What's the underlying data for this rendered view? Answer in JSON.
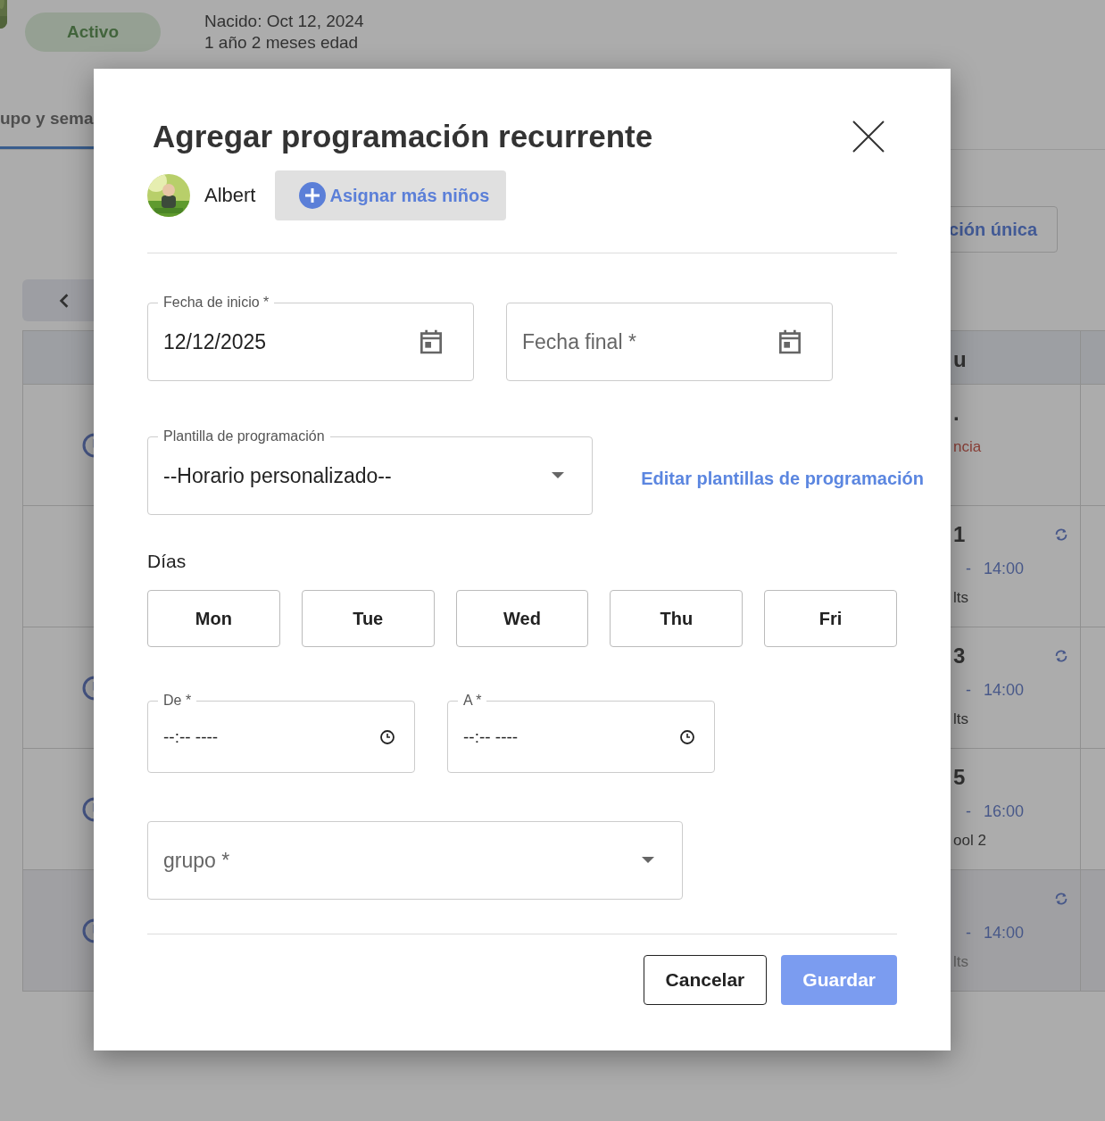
{
  "background": {
    "status": "Activo",
    "born": "Nacido: Oct 12, 2024",
    "age": "1 año 2 meses edad",
    "tab": "upo y sema",
    "one_time_button": "ción única",
    "table": {
      "header": "u",
      "rows": [
        {
          "clock": true,
          "day": ".",
          "note": "ncia",
          "time": "",
          "dash": "",
          "group": "",
          "recurring": false,
          "shaded": false
        },
        {
          "clock": false,
          "day": "1",
          "note": "",
          "time": "14:00",
          "dash": "-",
          "group": "lts",
          "recurring": true,
          "shaded": false
        },
        {
          "clock": true,
          "day": "3",
          "note": "",
          "time": "14:00",
          "dash": "-",
          "group": "lts",
          "recurring": true,
          "shaded": false
        },
        {
          "clock": true,
          "day": "5",
          "note": "",
          "time": "16:00",
          "dash": "-",
          "group": "ool 2",
          "recurring": false,
          "shaded": false
        },
        {
          "clock": true,
          "day": "",
          "note": "",
          "time": "14:00",
          "dash": "-",
          "group": "lts",
          "recurring": true,
          "shaded": true
        }
      ]
    }
  },
  "dialog": {
    "title": "Agregar programación recurrente",
    "child": {
      "name": "Albert"
    },
    "assign_button": "Asignar más niños",
    "start_date": {
      "label": "Fecha de inicio *",
      "value": "12/12/2025"
    },
    "end_date": {
      "placeholder": "Fecha final *"
    },
    "template": {
      "label": "Plantilla de programación",
      "value": "--Horario personalizado--"
    },
    "edit_templates_link": "Editar plantillas de programación",
    "days_label": "Días",
    "days": [
      {
        "label": "Mon",
        "selected": false
      },
      {
        "label": "Tue",
        "selected": false
      },
      {
        "label": "Wed",
        "selected": false
      },
      {
        "label": "Thu",
        "selected": false
      },
      {
        "label": "Fri",
        "selected": false
      }
    ],
    "from": {
      "label": "De *",
      "value": "--:-- ----"
    },
    "to": {
      "label": "A *",
      "value": "--:-- ----"
    },
    "group": {
      "placeholder": "grupo *"
    },
    "buttons": [
      {
        "label": "Cancelar",
        "kind": "secondary",
        "disabled": false
      },
      {
        "label": "Guardar",
        "kind": "primary",
        "disabled": true
      }
    ]
  }
}
